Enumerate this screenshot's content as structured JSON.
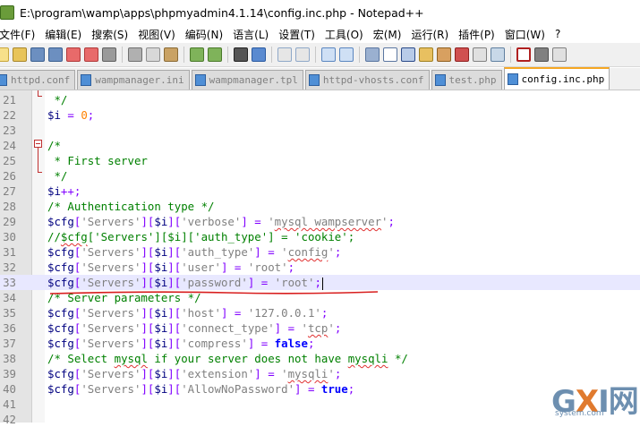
{
  "window": {
    "title": "E:\\program\\wamp\\apps\\phpmyadmin4.1.14\\config.inc.php - Notepad++"
  },
  "menu": [
    "文件(F)",
    "编辑(E)",
    "搜索(S)",
    "视图(V)",
    "编码(N)",
    "语言(L)",
    "设置(T)",
    "工具(O)",
    "宏(M)",
    "运行(R)",
    "插件(P)",
    "窗口(W)",
    "?"
  ],
  "tabs": [
    {
      "label": "httpd.conf",
      "active": false
    },
    {
      "label": "wampmanager.ini",
      "active": false
    },
    {
      "label": "wampmanager.tpl",
      "active": false
    },
    {
      "label": "httpd-vhosts.conf",
      "active": false
    },
    {
      "label": "test.php",
      "active": false
    },
    {
      "label": "config.inc.php",
      "active": true
    }
  ],
  "editor": {
    "lines": [
      {
        "n": "21",
        "segs": [
          [
            "cmt",
            " */"
          ]
        ]
      },
      {
        "n": "22",
        "segs": [
          [
            "var",
            "$i"
          ],
          [
            "op",
            " = "
          ],
          [
            "num-lit",
            "0"
          ],
          [
            "op",
            ";"
          ]
        ]
      },
      {
        "n": "23",
        "segs": []
      },
      {
        "n": "24",
        "segs": [
          [
            "cmt",
            "/*"
          ]
        ]
      },
      {
        "n": "25",
        "segs": [
          [
            "cmt",
            " * First server"
          ]
        ]
      },
      {
        "n": "26",
        "segs": [
          [
            "cmt",
            " */"
          ]
        ]
      },
      {
        "n": "27",
        "segs": [
          [
            "var",
            "$i"
          ],
          [
            "op",
            "++;"
          ]
        ]
      },
      {
        "n": "28",
        "segs": [
          [
            "cmt",
            "/* Authentication type */"
          ]
        ]
      },
      {
        "n": "29",
        "segs": [
          [
            "var",
            "$cfg"
          ],
          [
            "op",
            "["
          ],
          [
            "str",
            "'Servers'"
          ],
          [
            "op",
            "]["
          ],
          [
            "var",
            "$i"
          ],
          [
            "op",
            "]["
          ],
          [
            "str",
            "'verbose'"
          ],
          [
            "op",
            "] = "
          ],
          [
            "str",
            "'"
          ],
          [
            "strsq",
            "mysql wampserver"
          ],
          [
            "str",
            "'"
          ],
          [
            "op",
            ";"
          ]
        ]
      },
      {
        "n": "30",
        "segs": [
          [
            "cmt",
            "//"
          ],
          [
            "cmtsq",
            "$cfg"
          ],
          [
            "cmt",
            "['Servers'][$i]['auth_type'] = 'cookie';"
          ]
        ]
      },
      {
        "n": "31",
        "segs": [
          [
            "var",
            "$cfg"
          ],
          [
            "op",
            "["
          ],
          [
            "str",
            "'Servers'"
          ],
          [
            "op",
            "]["
          ],
          [
            "var",
            "$i"
          ],
          [
            "op",
            "]["
          ],
          [
            "str",
            "'auth_type'"
          ],
          [
            "op",
            "] = "
          ],
          [
            "str",
            "'"
          ],
          [
            "strsq",
            "config"
          ],
          [
            "str",
            "'"
          ],
          [
            "op",
            ";"
          ]
        ]
      },
      {
        "n": "32",
        "segs": [
          [
            "var",
            "$cfg"
          ],
          [
            "op",
            "["
          ],
          [
            "str",
            "'Servers'"
          ],
          [
            "op",
            "]["
          ],
          [
            "var",
            "$i"
          ],
          [
            "op",
            "]["
          ],
          [
            "str",
            "'user'"
          ],
          [
            "op",
            "] = "
          ],
          [
            "str",
            "'root'"
          ],
          [
            "op",
            ";"
          ]
        ]
      },
      {
        "n": "33",
        "segs": [
          [
            "var",
            "$cfg"
          ],
          [
            "op",
            "["
          ],
          [
            "str",
            "'Servers'"
          ],
          [
            "op",
            "]["
          ],
          [
            "var",
            "$i"
          ],
          [
            "op",
            "]["
          ],
          [
            "str",
            "'password'"
          ],
          [
            "op",
            "] = "
          ],
          [
            "str",
            "'root'"
          ],
          [
            "op",
            ";"
          ]
        ],
        "highlight": true
      },
      {
        "n": "34",
        "segs": [
          [
            "cmt",
            "/* Server parameters */"
          ]
        ]
      },
      {
        "n": "35",
        "segs": [
          [
            "var",
            "$cfg"
          ],
          [
            "op",
            "["
          ],
          [
            "str",
            "'Servers'"
          ],
          [
            "op",
            "]["
          ],
          [
            "var",
            "$i"
          ],
          [
            "op",
            "]["
          ],
          [
            "str",
            "'host'"
          ],
          [
            "op",
            "] = "
          ],
          [
            "str",
            "'127.0.0.1'"
          ],
          [
            "op",
            ";"
          ]
        ]
      },
      {
        "n": "36",
        "segs": [
          [
            "var",
            "$cfg"
          ],
          [
            "op",
            "["
          ],
          [
            "str",
            "'Servers'"
          ],
          [
            "op",
            "]["
          ],
          [
            "var",
            "$i"
          ],
          [
            "op",
            "]["
          ],
          [
            "str",
            "'connect_type'"
          ],
          [
            "op",
            "] = "
          ],
          [
            "str",
            "'"
          ],
          [
            "strsq",
            "tcp"
          ],
          [
            "str",
            "'"
          ],
          [
            "op",
            ";"
          ]
        ]
      },
      {
        "n": "37",
        "segs": [
          [
            "var",
            "$cfg"
          ],
          [
            "op",
            "["
          ],
          [
            "str",
            "'Servers'"
          ],
          [
            "op",
            "]["
          ],
          [
            "var",
            "$i"
          ],
          [
            "op",
            "]["
          ],
          [
            "str",
            "'compress'"
          ],
          [
            "op",
            "] = "
          ],
          [
            "kw",
            "false"
          ],
          [
            "op",
            ";"
          ]
        ]
      },
      {
        "n": "38",
        "segs": [
          [
            "cmt",
            "/* Select "
          ],
          [
            "cmtsq",
            "mysql"
          ],
          [
            "cmt",
            " if your server does not have "
          ],
          [
            "cmtsq",
            "mysqli"
          ],
          [
            "cmt",
            " */"
          ]
        ]
      },
      {
        "n": "39",
        "segs": [
          [
            "var",
            "$cfg"
          ],
          [
            "op",
            "["
          ],
          [
            "str",
            "'Servers'"
          ],
          [
            "op",
            "]["
          ],
          [
            "var",
            "$i"
          ],
          [
            "op",
            "]["
          ],
          [
            "str",
            "'extension'"
          ],
          [
            "op",
            "] = "
          ],
          [
            "str",
            "'"
          ],
          [
            "strsq",
            "mysqli"
          ],
          [
            "str",
            "'"
          ],
          [
            "op",
            ";"
          ]
        ]
      },
      {
        "n": "40",
        "segs": [
          [
            "var",
            "$cfg"
          ],
          [
            "op",
            "["
          ],
          [
            "str",
            "'Servers'"
          ],
          [
            "op",
            "]["
          ],
          [
            "var",
            "$i"
          ],
          [
            "op",
            "]["
          ],
          [
            "str",
            "'AllowNoPassword'"
          ],
          [
            "op",
            "] = "
          ],
          [
            "kw",
            "true"
          ],
          [
            "op",
            ";"
          ]
        ]
      },
      {
        "n": "41",
        "segs": []
      },
      {
        "n": "42",
        "segs": []
      }
    ]
  },
  "watermark": {
    "logo_g": "G",
    "logo_x": "X",
    "logo_i": "I",
    "logo_cn": "网",
    "site": "system.com"
  }
}
